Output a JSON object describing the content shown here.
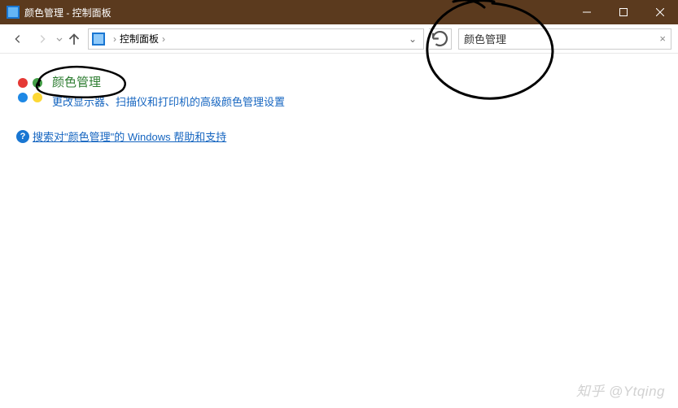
{
  "window": {
    "title": "颜色管理 - 控制面板"
  },
  "nav": {
    "location": "控制面板",
    "sep": "›",
    "dropdown_glyph": "⌄"
  },
  "search": {
    "value": "颜色管理",
    "clear_glyph": "×"
  },
  "result": {
    "title": "颜色管理",
    "desc": "更改显示器、扫描仪和打印机的高级颜色管理设置"
  },
  "help": {
    "icon_glyph": "?",
    "link": "搜索对\"颜色管理\"的 Windows 帮助和支持"
  },
  "watermark": "知乎 @Ytqing"
}
